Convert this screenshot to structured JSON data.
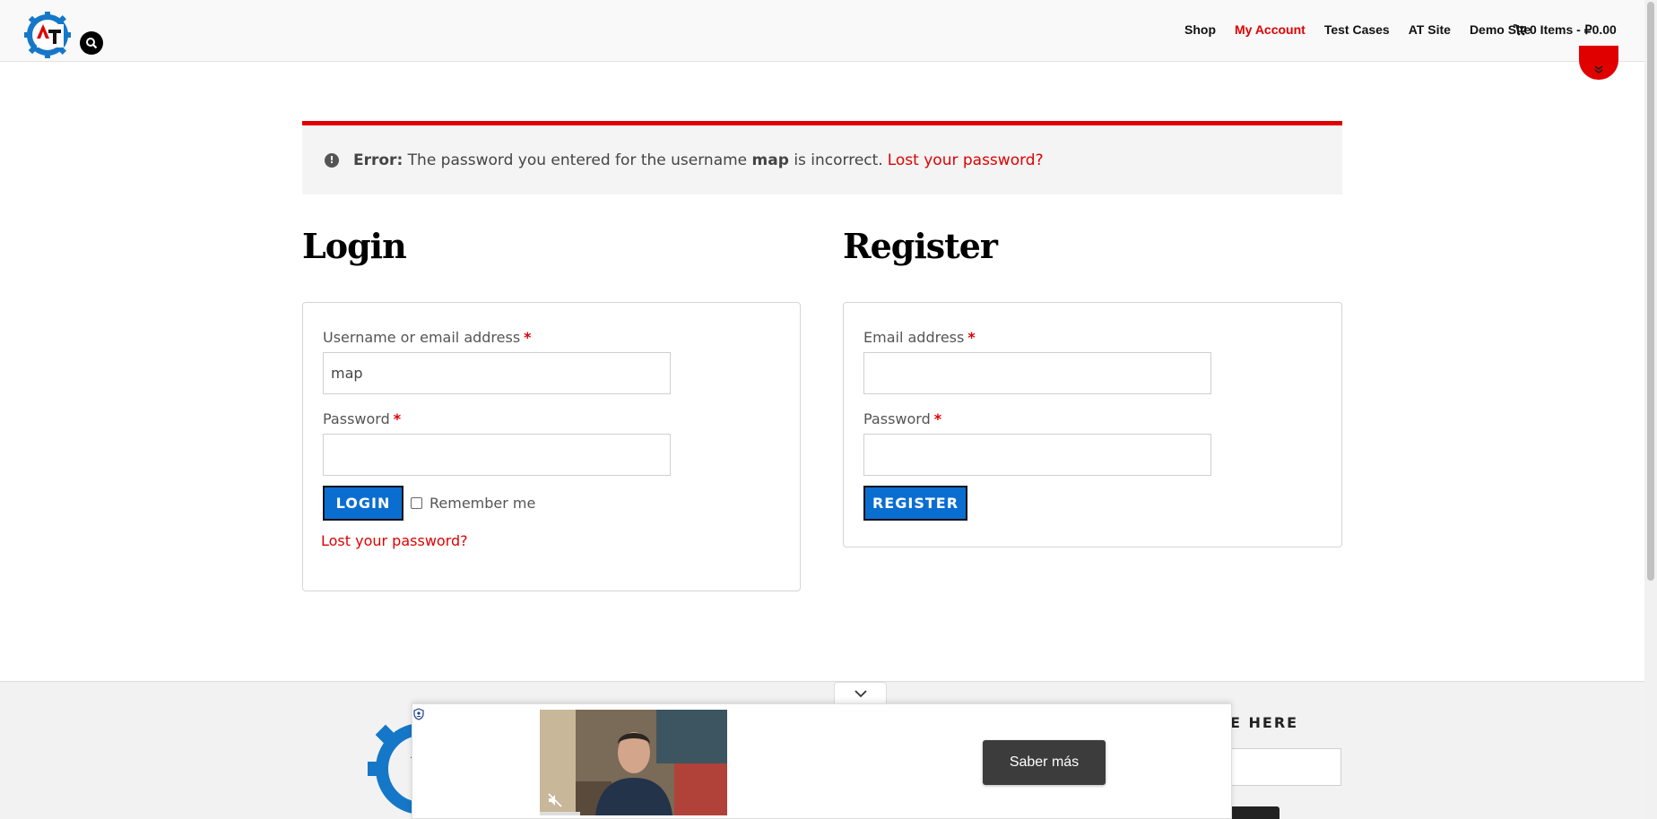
{
  "header": {
    "nav": [
      "Shop",
      "My Account",
      "Test Cases",
      "AT Site",
      "Demo Site"
    ],
    "active_nav": "My Account",
    "cart": "0 Items - ₽0.00"
  },
  "error": {
    "prefix": "Error:",
    "text1": "The password you entered for the username",
    "username": "map",
    "text2": "is incorrect.",
    "link": "Lost your password?"
  },
  "login": {
    "title": "Login",
    "username_label": "Username or email address",
    "username_value": "map",
    "password_label": "Password",
    "button": "LOGIN",
    "remember": "Remember me",
    "lost_link": "Lost your password?"
  },
  "register": {
    "title": "Register",
    "email_label": "Email address",
    "password_label": "Password",
    "button": "REGISTER"
  },
  "required_mark": "*",
  "footer": {
    "title": "E HERE"
  },
  "ad": {
    "button": "Saber más"
  },
  "colors": {
    "accent": "#e00000",
    "button": "#0a6ed1"
  }
}
